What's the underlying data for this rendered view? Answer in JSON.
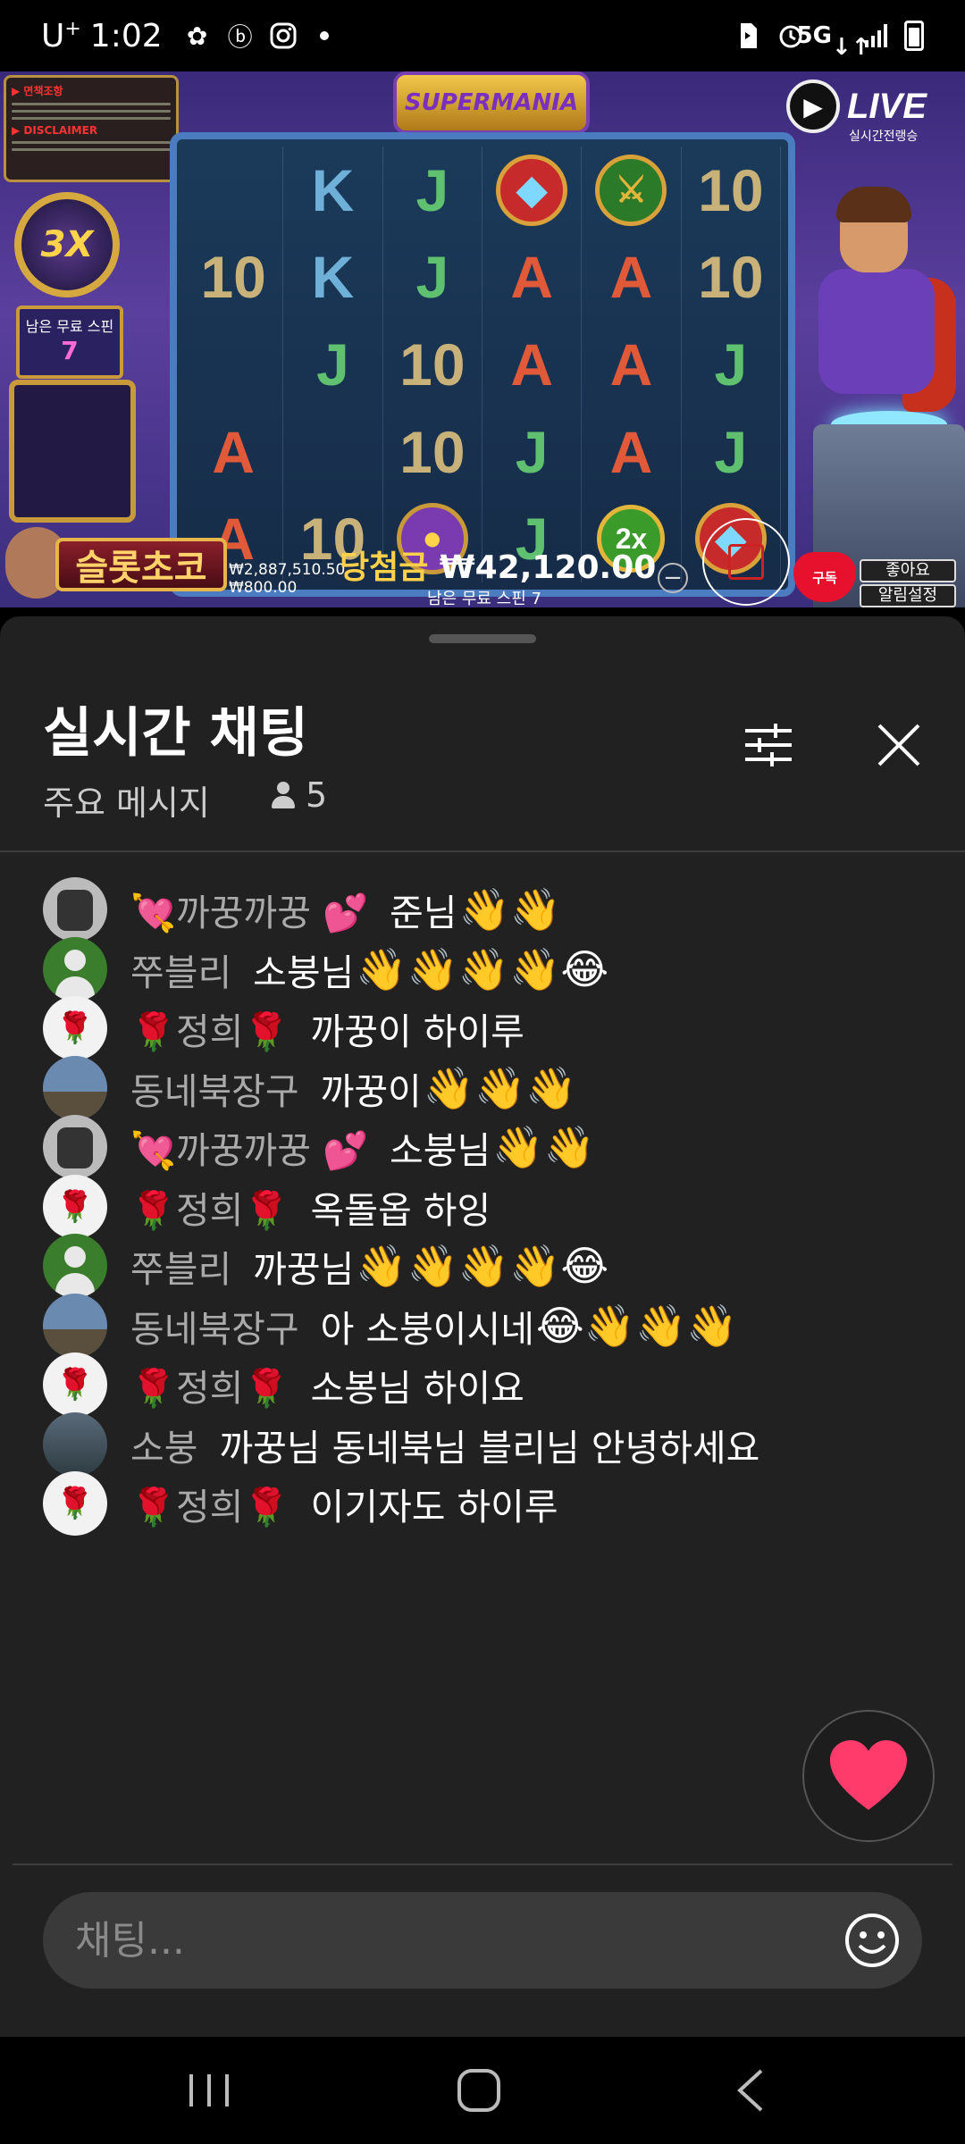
{
  "status_bar": {
    "carrier": "U",
    "carrier_sup": "+",
    "time": "1:02",
    "network": "5G",
    "icons": [
      "flower-icon",
      "b-app-icon",
      "instagram-icon",
      "notification-dot",
      "sim-icon",
      "alarm-icon",
      "5g-icon",
      "signal-icon",
      "battery-icon"
    ]
  },
  "video": {
    "game_logo": "SUPERMANIA",
    "live_label": "LIVE",
    "live_sub": "실시간전랭승",
    "multiplier": "3X",
    "free_spins_label": "남은 무료 스핀",
    "free_spins_count": "7",
    "info_tag1": "▶ 면책조항",
    "info_tag2": "▶ DISCLAIMER",
    "reels": [
      [
        "K",
        "J",
        "gem-red",
        "bracer-green",
        "10"
      ],
      [
        "10",
        "K",
        "J",
        "A",
        "A",
        "10"
      ],
      [
        "J",
        "10",
        "A",
        "A",
        "J"
      ],
      [
        "A",
        "10",
        "J",
        "A",
        "J"
      ],
      [
        "10",
        "orb-purple",
        "J",
        "2x",
        "gem-red"
      ],
      [
        "A"
      ]
    ],
    "grid": [
      [
        "",
        "K",
        "J",
        "◆",
        "⚔",
        "10"
      ],
      [
        "10",
        "K",
        "J",
        "A",
        "A",
        "10"
      ],
      [
        "",
        "J",
        "10",
        "A",
        "A",
        "J"
      ],
      [
        "A",
        "",
        "10",
        "J",
        "A",
        "J"
      ],
      [
        "A",
        "10",
        "●",
        "J",
        "2x",
        "◆"
      ]
    ],
    "brand_name": "슬롯초코",
    "balance_1": "₩2,887,510.50",
    "balance_2": "₩800.00",
    "win_label": "당첨금",
    "win_amount": "₩42,120.00",
    "win_sub": "남은 무료 스핀 7",
    "subscribe_label": "구독",
    "like_label": "좋아요",
    "alarm_label": "알림설정"
  },
  "chat": {
    "title": "실시간 채팅",
    "subtitle": "주요 메시지",
    "viewer_count": "5",
    "input_placeholder": "채팅...",
    "messages": [
      {
        "author": "💘까꿍까꿍 💕",
        "text": "준님",
        "emoji": "👋👋",
        "avatar": "cat"
      },
      {
        "author": "쭈블리",
        "text": "소붕님",
        "emoji": "👋👋👋👋😂",
        "avatar": "green"
      },
      {
        "author": "🌹정희🌹",
        "text": "까꿍이 하이루",
        "emoji": "",
        "avatar": "rose"
      },
      {
        "author": "동네북장구",
        "text": "까꿍이",
        "emoji": "👋👋👋",
        "avatar": "town"
      },
      {
        "author": "💘까꿍까꿍 💕",
        "text": "소붕님",
        "emoji": "👋👋",
        "avatar": "cat"
      },
      {
        "author": "🌹정희🌹",
        "text": "옥돌옵 하잉",
        "emoji": "",
        "avatar": "rose"
      },
      {
        "author": "쭈블리",
        "text": "까꿍님",
        "emoji": "👋👋👋👋😂",
        "avatar": "green"
      },
      {
        "author": "동네북장구",
        "text": "아 소붕이시네",
        "emoji": "😂👋👋👋",
        "avatar": "town"
      },
      {
        "author": "🌹정희🌹",
        "text": "소봉님 하이요",
        "emoji": "",
        "avatar": "rose"
      },
      {
        "author": "소붕",
        "text": "까꿍님 동네북님 블리님 안녕하세요",
        "emoji": "",
        "avatar": "sky"
      },
      {
        "author": "🌹정희🌹",
        "text": "이기자도 하이루",
        "emoji": "",
        "avatar": "rose"
      }
    ]
  },
  "colors": {
    "chat_bg": "#212121",
    "input_bg": "#3a3a3a",
    "heart": "#ff3b6b",
    "author": "#aaaaaa"
  }
}
